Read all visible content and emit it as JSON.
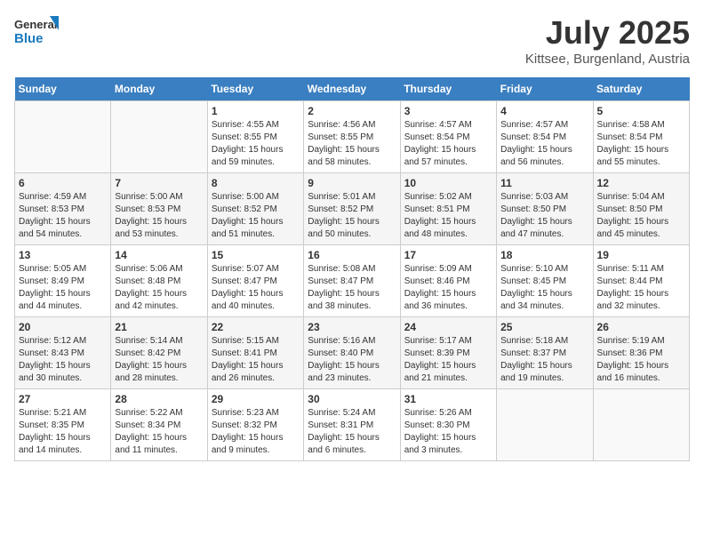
{
  "header": {
    "logo_general": "General",
    "logo_blue": "Blue",
    "month": "July 2025",
    "location": "Kittsee, Burgenland, Austria"
  },
  "days_of_week": [
    "Sunday",
    "Monday",
    "Tuesday",
    "Wednesday",
    "Thursday",
    "Friday",
    "Saturday"
  ],
  "weeks": [
    [
      {
        "day": "",
        "info": ""
      },
      {
        "day": "",
        "info": ""
      },
      {
        "day": "1",
        "info": "Sunrise: 4:55 AM\nSunset: 8:55 PM\nDaylight: 15 hours\nand 59 minutes."
      },
      {
        "day": "2",
        "info": "Sunrise: 4:56 AM\nSunset: 8:55 PM\nDaylight: 15 hours\nand 58 minutes."
      },
      {
        "day": "3",
        "info": "Sunrise: 4:57 AM\nSunset: 8:54 PM\nDaylight: 15 hours\nand 57 minutes."
      },
      {
        "day": "4",
        "info": "Sunrise: 4:57 AM\nSunset: 8:54 PM\nDaylight: 15 hours\nand 56 minutes."
      },
      {
        "day": "5",
        "info": "Sunrise: 4:58 AM\nSunset: 8:54 PM\nDaylight: 15 hours\nand 55 minutes."
      }
    ],
    [
      {
        "day": "6",
        "info": "Sunrise: 4:59 AM\nSunset: 8:53 PM\nDaylight: 15 hours\nand 54 minutes."
      },
      {
        "day": "7",
        "info": "Sunrise: 5:00 AM\nSunset: 8:53 PM\nDaylight: 15 hours\nand 53 minutes."
      },
      {
        "day": "8",
        "info": "Sunrise: 5:00 AM\nSunset: 8:52 PM\nDaylight: 15 hours\nand 51 minutes."
      },
      {
        "day": "9",
        "info": "Sunrise: 5:01 AM\nSunset: 8:52 PM\nDaylight: 15 hours\nand 50 minutes."
      },
      {
        "day": "10",
        "info": "Sunrise: 5:02 AM\nSunset: 8:51 PM\nDaylight: 15 hours\nand 48 minutes."
      },
      {
        "day": "11",
        "info": "Sunrise: 5:03 AM\nSunset: 8:50 PM\nDaylight: 15 hours\nand 47 minutes."
      },
      {
        "day": "12",
        "info": "Sunrise: 5:04 AM\nSunset: 8:50 PM\nDaylight: 15 hours\nand 45 minutes."
      }
    ],
    [
      {
        "day": "13",
        "info": "Sunrise: 5:05 AM\nSunset: 8:49 PM\nDaylight: 15 hours\nand 44 minutes."
      },
      {
        "day": "14",
        "info": "Sunrise: 5:06 AM\nSunset: 8:48 PM\nDaylight: 15 hours\nand 42 minutes."
      },
      {
        "day": "15",
        "info": "Sunrise: 5:07 AM\nSunset: 8:47 PM\nDaylight: 15 hours\nand 40 minutes."
      },
      {
        "day": "16",
        "info": "Sunrise: 5:08 AM\nSunset: 8:47 PM\nDaylight: 15 hours\nand 38 minutes."
      },
      {
        "day": "17",
        "info": "Sunrise: 5:09 AM\nSunset: 8:46 PM\nDaylight: 15 hours\nand 36 minutes."
      },
      {
        "day": "18",
        "info": "Sunrise: 5:10 AM\nSunset: 8:45 PM\nDaylight: 15 hours\nand 34 minutes."
      },
      {
        "day": "19",
        "info": "Sunrise: 5:11 AM\nSunset: 8:44 PM\nDaylight: 15 hours\nand 32 minutes."
      }
    ],
    [
      {
        "day": "20",
        "info": "Sunrise: 5:12 AM\nSunset: 8:43 PM\nDaylight: 15 hours\nand 30 minutes."
      },
      {
        "day": "21",
        "info": "Sunrise: 5:14 AM\nSunset: 8:42 PM\nDaylight: 15 hours\nand 28 minutes."
      },
      {
        "day": "22",
        "info": "Sunrise: 5:15 AM\nSunset: 8:41 PM\nDaylight: 15 hours\nand 26 minutes."
      },
      {
        "day": "23",
        "info": "Sunrise: 5:16 AM\nSunset: 8:40 PM\nDaylight: 15 hours\nand 23 minutes."
      },
      {
        "day": "24",
        "info": "Sunrise: 5:17 AM\nSunset: 8:39 PM\nDaylight: 15 hours\nand 21 minutes."
      },
      {
        "day": "25",
        "info": "Sunrise: 5:18 AM\nSunset: 8:37 PM\nDaylight: 15 hours\nand 19 minutes."
      },
      {
        "day": "26",
        "info": "Sunrise: 5:19 AM\nSunset: 8:36 PM\nDaylight: 15 hours\nand 16 minutes."
      }
    ],
    [
      {
        "day": "27",
        "info": "Sunrise: 5:21 AM\nSunset: 8:35 PM\nDaylight: 15 hours\nand 14 minutes."
      },
      {
        "day": "28",
        "info": "Sunrise: 5:22 AM\nSunset: 8:34 PM\nDaylight: 15 hours\nand 11 minutes."
      },
      {
        "day": "29",
        "info": "Sunrise: 5:23 AM\nSunset: 8:32 PM\nDaylight: 15 hours\nand 9 minutes."
      },
      {
        "day": "30",
        "info": "Sunrise: 5:24 AM\nSunset: 8:31 PM\nDaylight: 15 hours\nand 6 minutes."
      },
      {
        "day": "31",
        "info": "Sunrise: 5:26 AM\nSunset: 8:30 PM\nDaylight: 15 hours\nand 3 minutes."
      },
      {
        "day": "",
        "info": ""
      },
      {
        "day": "",
        "info": ""
      }
    ]
  ]
}
